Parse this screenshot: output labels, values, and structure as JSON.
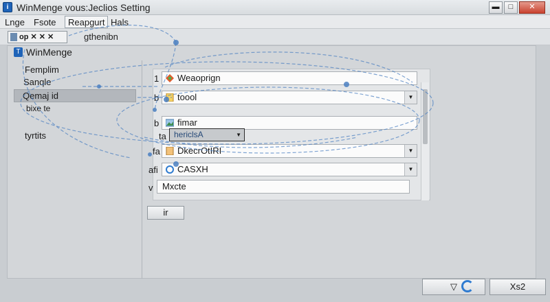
{
  "window": {
    "title": "WinMenge vous:Jeclios Setting",
    "minimize_glyph": "▬",
    "maximize_glyph": "□",
    "close_glyph": "✕"
  },
  "menu": {
    "items": [
      {
        "label": "Lnge"
      },
      {
        "label": "Fsote"
      },
      {
        "label": "Reapgurt"
      },
      {
        "label": "Hals"
      }
    ]
  },
  "toolbar": {
    "group_text": "op  ✕  ✕ ✕",
    "label": "gthenibn"
  },
  "tree": {
    "header": "WinMenge",
    "items": [
      {
        "label": "Femplim"
      },
      {
        "label": "Sanqle"
      },
      {
        "label": "Qemaj id"
      },
      {
        "label": "bixe te"
      },
      {
        "label": "tyrtits"
      }
    ]
  },
  "form": {
    "rows": [
      {
        "key": "1",
        "value": "Weaoprign",
        "icon": "diamond-icon"
      },
      {
        "key": "b",
        "value": "toool",
        "icon": "document-icon"
      },
      {
        "key": "b",
        "value": "fimar",
        "icon": "image-icon"
      },
      {
        "key": "ta",
        "value": ""
      },
      {
        "key": "fa",
        "value": "DkecrOtIRI",
        "icon": "document-icon"
      },
      {
        "key": "afi",
        "value": "CASXH",
        "icon": "circle-icon"
      },
      {
        "key": "v",
        "value": "Mxcte"
      }
    ],
    "popup_value": "hericlsA",
    "apply_label": "ir"
  },
  "buttons": {
    "ok_glyph": "▽",
    "cancel_label": "Xs2"
  },
  "colors": {
    "accent": "#1e63b8",
    "overlay_line": "#4a7fc1"
  }
}
